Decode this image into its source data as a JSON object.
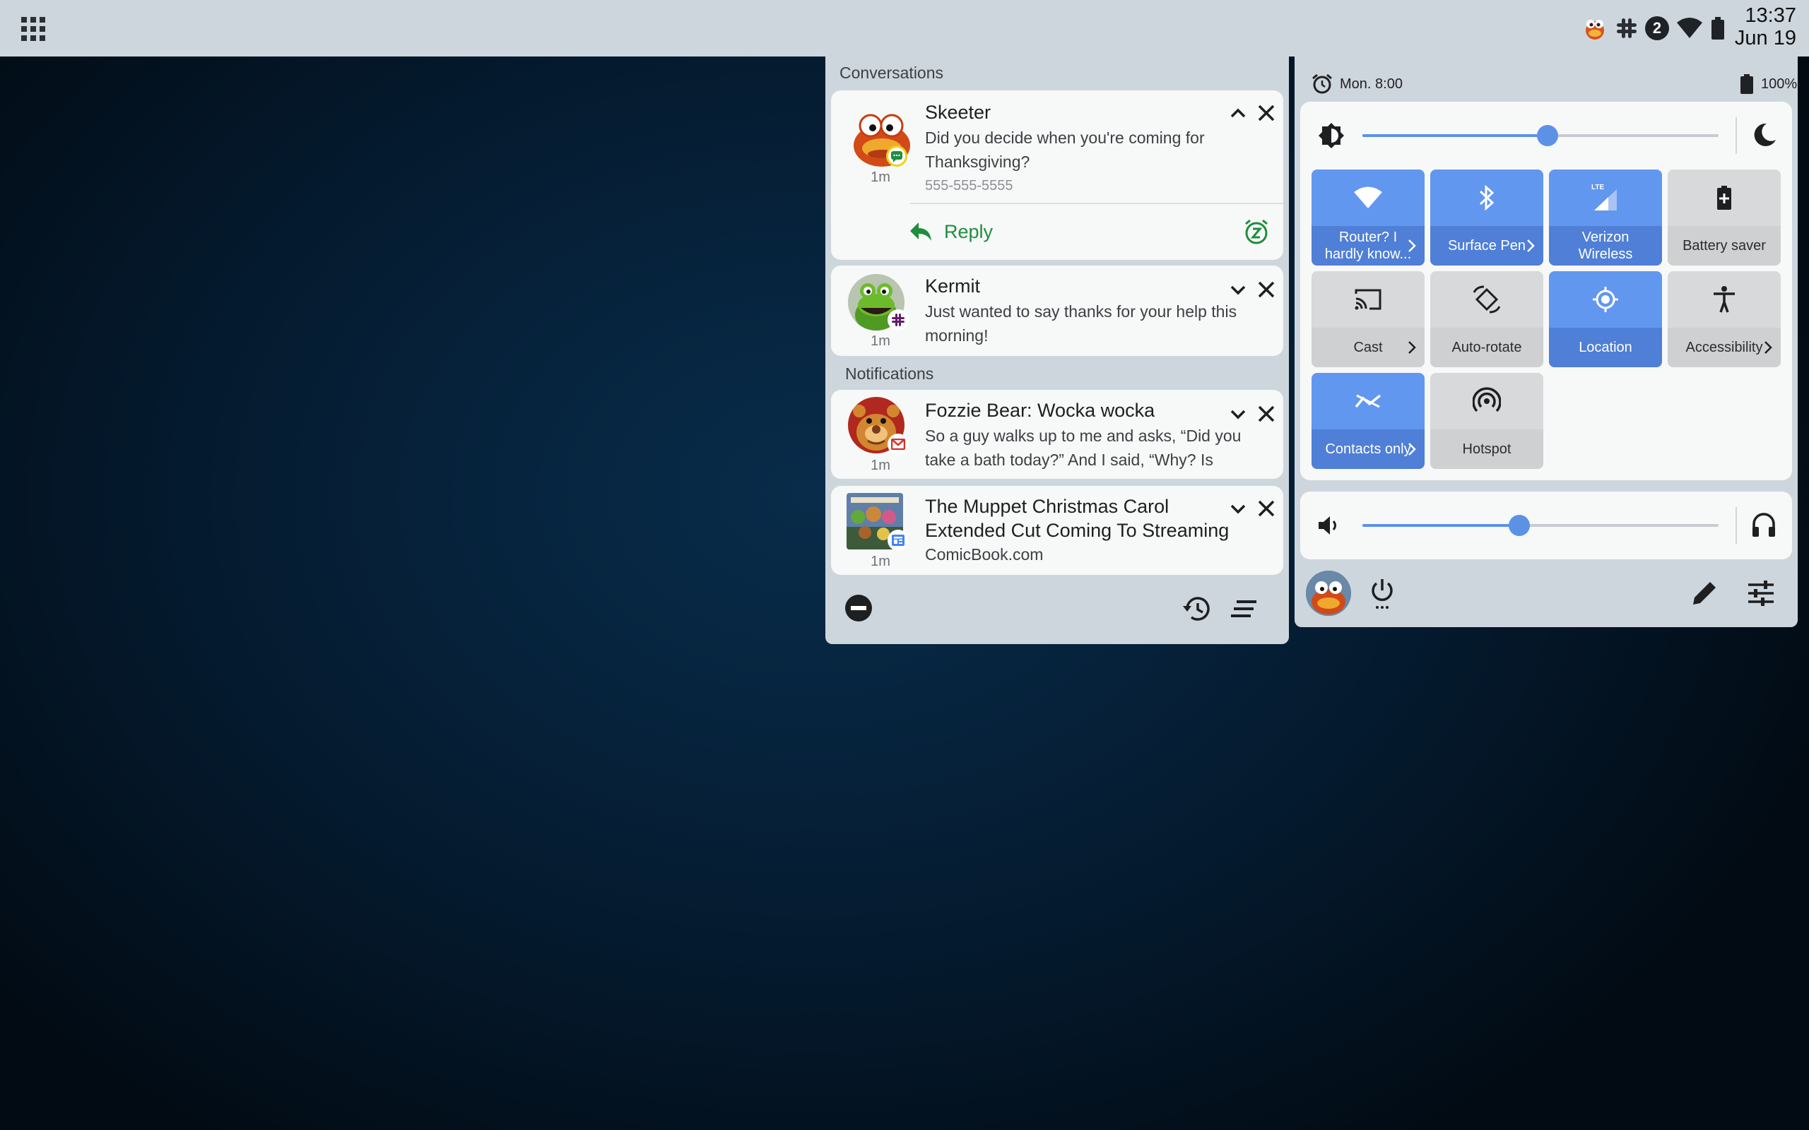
{
  "status_bar": {
    "time": "13:37",
    "date": "Jun 19",
    "notification_count": "2",
    "icons": [
      "apps-grid-icon",
      "skeeter-app-icon",
      "slack-icon",
      "count-badge",
      "wifi-icon",
      "battery-icon"
    ]
  },
  "notifications": {
    "conversations_label": "Conversations",
    "notifications_label": "Notifications",
    "skeeter": {
      "title": "Skeeter",
      "text": "Did you decide when you're coming for Thanksgiving?",
      "phone": "555-555-5555",
      "age": "1m",
      "reply_label": "Reply",
      "app_icon": "messages-icon"
    },
    "kermit": {
      "title": "Kermit",
      "text": "Just wanted to say thanks for your help this morning!",
      "age": "1m",
      "app_icon": "slack-icon"
    },
    "fozzie": {
      "title": "Fozzie Bear: Wocka wocka",
      "text": "So a guy walks up to me and asks, “Did you take a bath today?”  And I said, “Why?  Is",
      "age": "1m",
      "app_icon": "gmail-icon"
    },
    "muppet": {
      "title": "The Muppet Christmas Carol Extended Cut Coming To Streaming",
      "text": "ComicBook.com",
      "age": "1m",
      "app_icon": "news-icon"
    },
    "footer_icons": [
      "do-not-disturb-icon",
      "history-icon",
      "clear-all-icon"
    ]
  },
  "quick_settings": {
    "alarm": "Mon. 8:00",
    "battery": "100%",
    "brightness": 0.52,
    "volume": 0.44,
    "tiles": [
      {
        "label": "Router? I hardly know...",
        "active": true,
        "chevron": true,
        "icon": "wifi-icon"
      },
      {
        "label": "Surface Pen",
        "active": true,
        "chevron": true,
        "icon": "bluetooth-icon"
      },
      {
        "label": "Verizon Wireless",
        "active": true,
        "chevron": false,
        "icon": "lte-signal-icon",
        "icon_text": "LTE"
      },
      {
        "label": "Battery saver",
        "active": false,
        "chevron": false,
        "icon": "battery-saver-icon"
      },
      {
        "label": "Cast",
        "active": false,
        "chevron": true,
        "icon": "cast-icon"
      },
      {
        "label": "Auto-rotate",
        "active": false,
        "chevron": false,
        "icon": "auto-rotate-icon"
      },
      {
        "label": "Location",
        "active": true,
        "chevron": false,
        "icon": "location-icon"
      },
      {
        "label": "Accessibility",
        "active": false,
        "chevron": true,
        "icon": "accessibility-icon"
      },
      {
        "label": "Contacts only",
        "active": true,
        "chevron": true,
        "icon": "contacts-only-icon"
      },
      {
        "label": "Hotspot",
        "active": false,
        "chevron": false,
        "icon": "hotspot-icon"
      }
    ],
    "bottom_icons": [
      "user-avatar",
      "power-icon",
      "edit-icon",
      "settings-sliders-icon"
    ]
  },
  "colors": {
    "accent": "#5c92e6",
    "tile_active": "#6197ef",
    "tile_inactive": "#d8d9da",
    "reply_green": "#1e8e3e",
    "panel_bg": "#ced6dd",
    "card_bg": "#f7f8f8"
  }
}
